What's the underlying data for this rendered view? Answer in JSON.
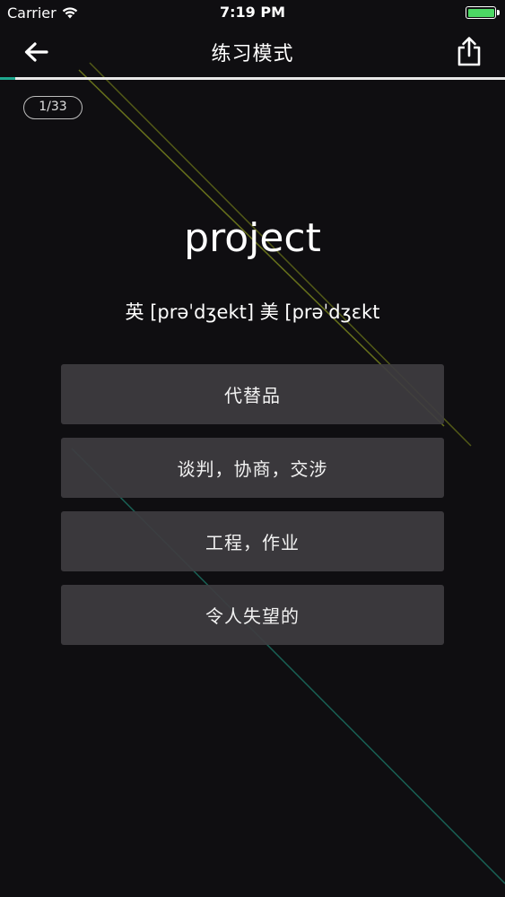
{
  "status_bar": {
    "carrier": "Carrier",
    "time": "7:19 PM"
  },
  "nav": {
    "title": "练习模式",
    "back_icon": "arrow-left-icon",
    "share_icon": "share-icon"
  },
  "progress": {
    "current": 1,
    "total": 33,
    "fraction": 0.03
  },
  "counter": "1/33",
  "word": "project",
  "phonetic": "英 [prəˈdʒekt] 美 [prəˈdʒɛkt",
  "options": [
    {
      "label": "代替品"
    },
    {
      "label": "谈判，协商，交涉"
    },
    {
      "label": "工程，作业"
    },
    {
      "label": "令人失望的"
    }
  ],
  "colors": {
    "background": "#0f0e11",
    "accent": "#1fa88f",
    "option_bg": "#3e3c40",
    "battery": "#4cd964"
  }
}
